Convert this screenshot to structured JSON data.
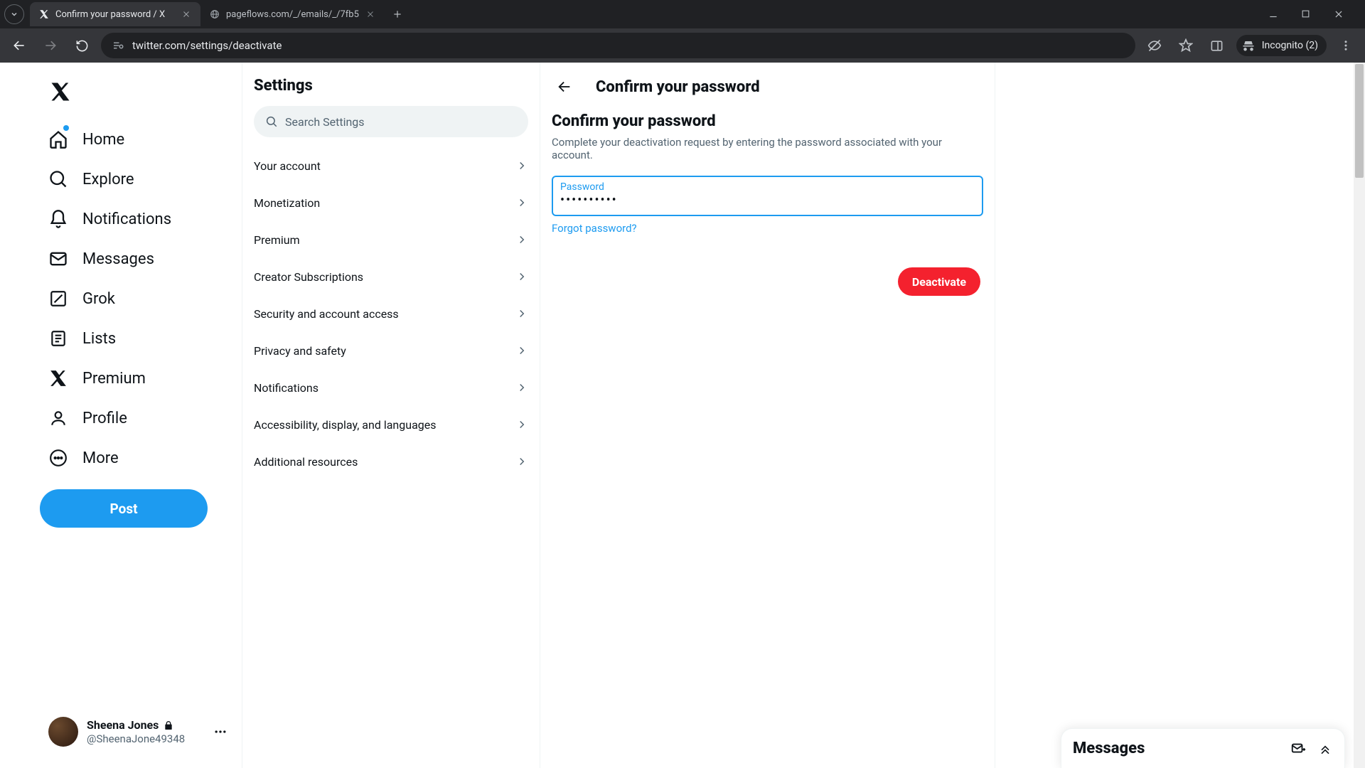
{
  "browser": {
    "tabs": [
      {
        "title": "Confirm your password / X"
      },
      {
        "title": "pageflows.com/_/emails/_/7fb5"
      }
    ],
    "url": "twitter.com/settings/deactivate",
    "incognito_label": "Incognito (2)"
  },
  "nav": {
    "items": [
      {
        "label": "Home",
        "icon": "home-icon",
        "dot": true
      },
      {
        "label": "Explore",
        "icon": "search-icon"
      },
      {
        "label": "Notifications",
        "icon": "bell-icon"
      },
      {
        "label": "Messages",
        "icon": "mail-icon"
      },
      {
        "label": "Grok",
        "icon": "grok-icon"
      },
      {
        "label": "Lists",
        "icon": "lists-icon"
      },
      {
        "label": "Premium",
        "icon": "x-icon"
      },
      {
        "label": "Profile",
        "icon": "profile-icon"
      },
      {
        "label": "More",
        "icon": "more-icon"
      }
    ],
    "post_label": "Post"
  },
  "account": {
    "display_name": "Sheena Jones",
    "handle": "@SheenaJone49348"
  },
  "settings": {
    "title": "Settings",
    "search_placeholder": "Search Settings",
    "items": [
      "Your account",
      "Monetization",
      "Premium",
      "Creator Subscriptions",
      "Security and account access",
      "Privacy and safety",
      "Notifications",
      "Accessibility, display, and languages",
      "Additional resources"
    ]
  },
  "detail": {
    "header_title": "Confirm your password",
    "sub_title": "Confirm your password",
    "sub_desc": "Complete your deactivation request by entering the password associated with your account.",
    "password_label": "Password",
    "password_value": "••••••••••",
    "forgot_label": "Forgot password?",
    "deactivate_label": "Deactivate"
  },
  "messages_drawer": {
    "title": "Messages"
  }
}
